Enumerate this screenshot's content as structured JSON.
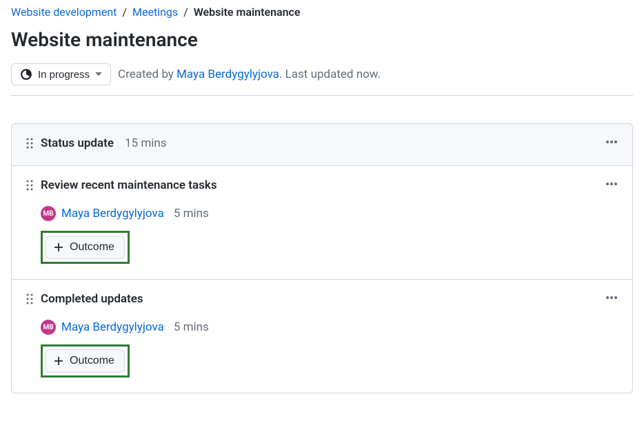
{
  "breadcrumb": {
    "items": [
      {
        "label": "Website development"
      },
      {
        "label": "Meetings"
      }
    ],
    "current": "Website maintenance",
    "sep": "/"
  },
  "page_title": "Website maintenance",
  "status": {
    "label": "In progress"
  },
  "meta": {
    "created_by_prefix": "Created by ",
    "author": "Maya Berdygylyjova",
    "period": ".",
    "updated": " Last updated now."
  },
  "sections": [
    {
      "title": "Status update",
      "time": "15 mins"
    },
    {
      "title": "Review recent maintenance tasks",
      "assignee": {
        "initials": "MB",
        "name": "Maya Berdygylyjova",
        "time": "5 mins"
      },
      "outcome_label": "Outcome"
    },
    {
      "title": "Completed updates",
      "assignee": {
        "initials": "MB",
        "name": "Maya Berdygylyjova",
        "time": "5 mins"
      },
      "outcome_label": "Outcome"
    }
  ]
}
